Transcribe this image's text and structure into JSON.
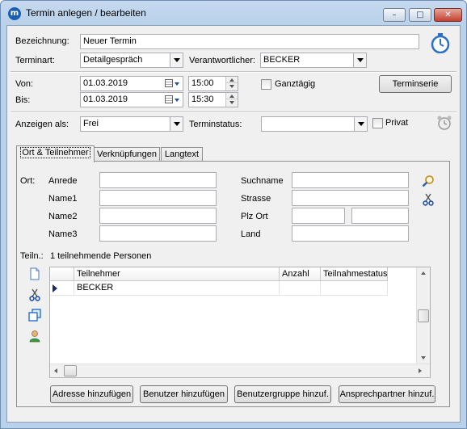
{
  "window": {
    "title": "Termin anlegen / bearbeiten"
  },
  "form": {
    "bezeichnung_label": "Bezeichnung:",
    "bezeichnung_value": "Neuer Termin",
    "terminart_label": "Terminart:",
    "terminart_value": "Detailgespräch",
    "verantwortlicher_label": "Verantwortlicher:",
    "verantwortlicher_value": "BECKER",
    "von_label": "Von:",
    "von_date": "01.03.2019",
    "von_time": "15:00",
    "bis_label": "Bis:",
    "bis_date": "01.03.2019",
    "bis_time": "15:30",
    "ganztaegig_label": "Ganztägig",
    "terminserie_label": "Terminserie",
    "anzeigen_label": "Anzeigen als:",
    "anzeigen_value": "Frei",
    "terminstatus_label": "Terminstatus:",
    "terminstatus_value": "",
    "privat_label": "Privat"
  },
  "tabs": [
    {
      "label": "Ort & Teilnehmer",
      "active": true
    },
    {
      "label": "Verknüpfungen",
      "active": false
    },
    {
      "label": "Langtext",
      "active": false
    }
  ],
  "ort": {
    "ort_label": "Ort:",
    "anrede_label": "Anrede",
    "name1_label": "Name1",
    "name2_label": "Name2",
    "name3_label": "Name3",
    "suchname_label": "Suchname",
    "strasse_label": "Strasse",
    "plzort_label": "Plz Ort",
    "land_label": "Land"
  },
  "teilnehmer": {
    "label": "Teiln.:",
    "count_text": "1 teilnehmende Personen",
    "columns": [
      "Teilnehmer",
      "Anzahl",
      "Teilnahmestatus"
    ],
    "rows": [
      {
        "teilnehmer": "BECKER",
        "anzahl": "",
        "status": ""
      }
    ]
  },
  "buttons": {
    "adresse": "Adresse hinzufügen",
    "benutzer": "Benutzer hinzufügen",
    "benutzergruppe": "Benutzergruppe hinzuf.",
    "ansprechpartner": "Ansprechpartner hinzuf."
  },
  "icons": {
    "app": "app-logo-icon",
    "stopwatch": "stopwatch-icon",
    "alarm": "alarm-clock-icon",
    "search": "magnifier-icon",
    "cut": "scissors-icon",
    "new": "new-document-icon",
    "copy": "copy-windows-icon",
    "person": "person-icon"
  },
  "colors": {
    "accent": "#1c5fb0",
    "titlebar": "#b9d1ea",
    "close": "#c4402f"
  }
}
